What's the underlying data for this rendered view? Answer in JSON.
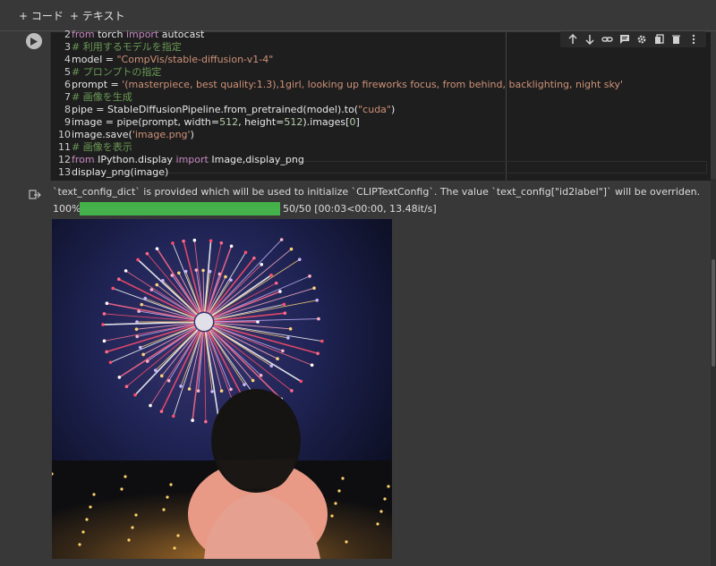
{
  "toolbar": {
    "add_code": "+ コード",
    "add_text": "+ テキスト"
  },
  "code_lines": [
    {
      "n": "2",
      "t": "from torch import autocast"
    },
    {
      "n": "3",
      "t": "# 利用するモデルを指定"
    },
    {
      "n": "4",
      "t": "model = \"CompVis/stable-diffusion-v1-4\""
    },
    {
      "n": "5",
      "t": "# プロンプトの指定"
    },
    {
      "n": "6",
      "t": "prompt = '(masterpiece, best quality:1.3),1girl, looking up fireworks focus, from behind, backlighting, night sky'"
    },
    {
      "n": "7",
      "t": "# 画像を生成"
    },
    {
      "n": "8",
      "t": "pipe = StableDiffusionPipeline.from_pretrained(model).to(\"cuda\")"
    },
    {
      "n": "9",
      "t": "image = pipe(prompt, width=512, height=512).images[0]"
    },
    {
      "n": "10",
      "t": "image.save('image.png')"
    },
    {
      "n": "11",
      "t": "# 画像を表示"
    },
    {
      "n": "12",
      "t": "from IPython.display import Image,display_png"
    },
    {
      "n": "13",
      "t": "display_png(image)"
    }
  ],
  "cell_tools": [
    "arrow-up-icon",
    "arrow-down-icon",
    "link-icon",
    "comment-icon",
    "gear-icon",
    "mirror-icon",
    "trash-icon",
    "more-icon"
  ],
  "output": {
    "warning": "`text_config_dict` is provided which will be used to initialize `CLIPTextConfig`. The value `text_config[\"id2label\"]` will be overriden.",
    "progress_percent": "100%",
    "progress_fraction": 1.0,
    "progress_stats": "50/50 [00:03<00:00, 13.48it/s]"
  },
  "colors": {
    "progress_fill": "#44b14a",
    "code_bg": "#1e1e1e",
    "page_bg": "#383838"
  }
}
